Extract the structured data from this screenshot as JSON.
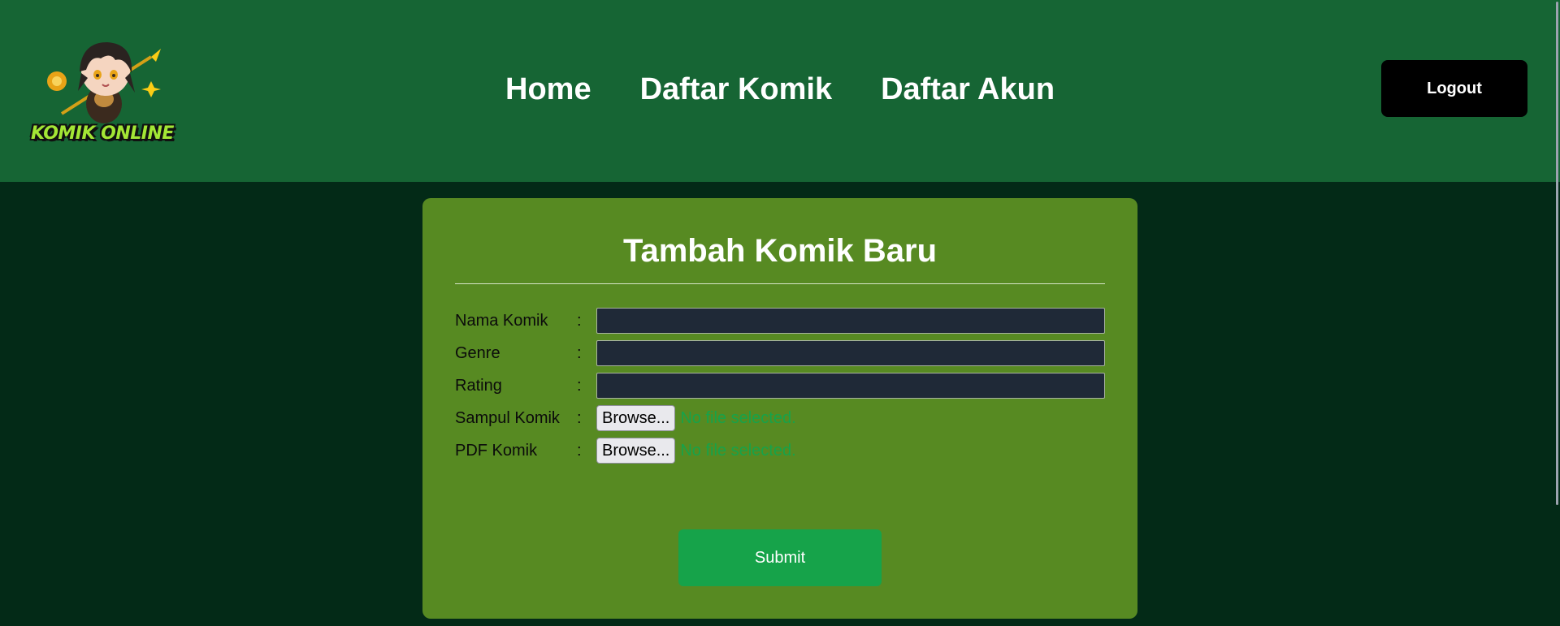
{
  "header": {
    "logo_text": "KOMIK ONLINE",
    "nav": [
      {
        "label": "Home"
      },
      {
        "label": "Daftar Komik"
      },
      {
        "label": "Daftar Akun"
      }
    ],
    "logout_label": "Logout"
  },
  "form": {
    "title": "Tambah Komik Baru",
    "fields": {
      "nama_komik": {
        "label": "Nama Komik",
        "colon": ":",
        "value": ""
      },
      "genre": {
        "label": "Genre",
        "colon": ":",
        "value": ""
      },
      "rating": {
        "label": "Rating",
        "colon": ":",
        "value": ""
      },
      "sampul_komik": {
        "label": "Sampul Komik",
        "colon": ":",
        "button": "Browse...",
        "status": "No file selected."
      },
      "pdf_komik": {
        "label": "PDF Komik",
        "colon": ":",
        "button": "Browse...",
        "status": "No file selected."
      }
    },
    "submit_label": "Submit"
  },
  "colors": {
    "header_bg": "#166534",
    "page_bg": "#032a17",
    "card_bg": "#578a22",
    "input_bg": "#1f2937",
    "submit_bg": "#16a34a",
    "logout_bg": "#000000",
    "file_status": "#16a34a"
  }
}
